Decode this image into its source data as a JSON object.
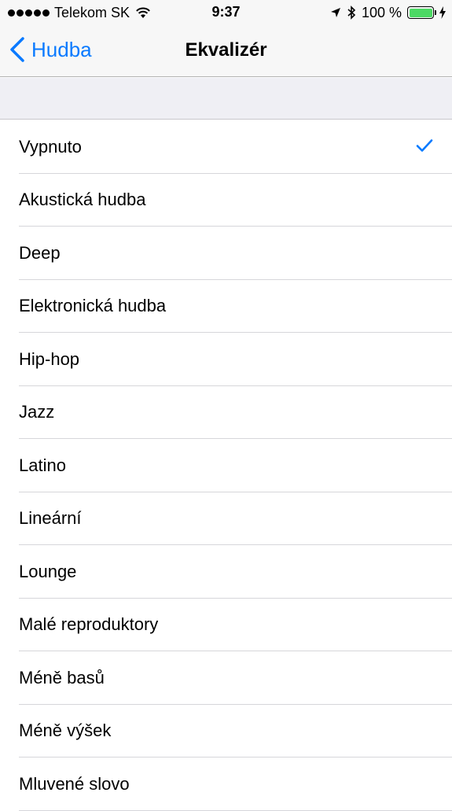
{
  "status_bar": {
    "carrier": "Telekom SK",
    "time": "9:37",
    "battery": "100 %",
    "signal_bars": 5,
    "battery_level": 1.0,
    "icons": [
      "signal-dots-icon",
      "wifi-icon",
      "location-arrow-icon",
      "bluetooth-icon",
      "battery-icon",
      "charging-bolt-icon"
    ]
  },
  "nav": {
    "back_label": "Hudba",
    "title": "Ekvalizér"
  },
  "colors": {
    "accent": "#0a7aff",
    "battery_fill": "#4cd964",
    "group_background": "#efeff4"
  },
  "equalizer": {
    "selected": "Vypnuto",
    "items": [
      {
        "label": "Vypnuto"
      },
      {
        "label": "Akustická hudba"
      },
      {
        "label": "Deep"
      },
      {
        "label": "Elektronická hudba"
      },
      {
        "label": "Hip-hop"
      },
      {
        "label": "Jazz"
      },
      {
        "label": "Latino"
      },
      {
        "label": "Lineární"
      },
      {
        "label": "Lounge"
      },
      {
        "label": "Malé reproduktory"
      },
      {
        "label": "Méně basů"
      },
      {
        "label": "Méně výšek"
      },
      {
        "label": "Mluvené slovo"
      }
    ]
  }
}
